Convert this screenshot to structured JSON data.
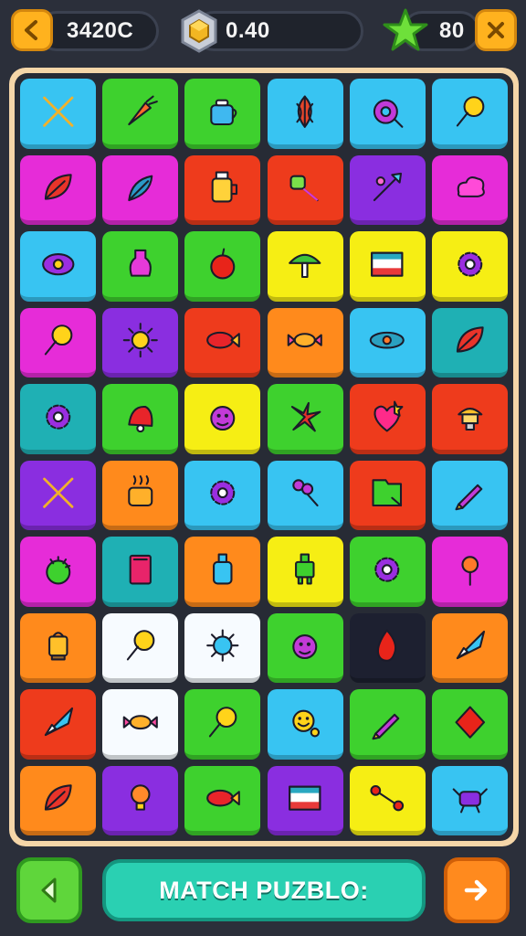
{
  "hud": {
    "score": "3420C",
    "gems": "0.40",
    "stars": "80"
  },
  "footer": {
    "title": "MATCH PUZBLO:"
  },
  "colors": {
    "blue": "#38c4f2",
    "green": "#3ed12e",
    "magenta": "#e62cd8",
    "red": "#ee3b1c",
    "purple": "#8a2ee0",
    "yellow": "#f6ee14",
    "orange": "#ff8a1c",
    "teal": "#1fb0b4",
    "dark": "#1d2030",
    "white": "#f7fbff"
  },
  "board": {
    "columns": 6,
    "rows": 10,
    "tiles": [
      {
        "bg": "blue",
        "icon": "crossed-swords-icon"
      },
      {
        "bg": "green",
        "icon": "carrot-icon"
      },
      {
        "bg": "green",
        "icon": "teapot-icon"
      },
      {
        "bg": "blue",
        "icon": "shell-icon"
      },
      {
        "bg": "blue",
        "icon": "donut-icon"
      },
      {
        "bg": "blue",
        "icon": "lollipop-icon"
      },
      {
        "bg": "magenta",
        "icon": "leaf-icon"
      },
      {
        "bg": "magenta",
        "icon": "feather-icon"
      },
      {
        "bg": "red",
        "icon": "jar-icon"
      },
      {
        "bg": "red",
        "icon": "key-icon"
      },
      {
        "bg": "purple",
        "icon": "arrow-icon"
      },
      {
        "bg": "magenta",
        "icon": "cloud-icon"
      },
      {
        "bg": "blue",
        "icon": "eye-icon"
      },
      {
        "bg": "green",
        "icon": "potion-icon"
      },
      {
        "bg": "green",
        "icon": "apple-icon"
      },
      {
        "bg": "yellow",
        "icon": "mushroom-icon"
      },
      {
        "bg": "yellow",
        "icon": "flag-icon"
      },
      {
        "bg": "yellow",
        "icon": "gear-icon"
      },
      {
        "bg": "magenta",
        "icon": "lollipop-icon"
      },
      {
        "bg": "purple",
        "icon": "sun-icon"
      },
      {
        "bg": "red",
        "icon": "fish-icon"
      },
      {
        "bg": "orange",
        "icon": "candy-icon"
      },
      {
        "bg": "blue",
        "icon": "planet-icon"
      },
      {
        "bg": "teal",
        "icon": "leaf-icon"
      },
      {
        "bg": "teal",
        "icon": "gear-icon"
      },
      {
        "bg": "green",
        "icon": "bell-icon"
      },
      {
        "bg": "yellow",
        "icon": "monster-icon"
      },
      {
        "bg": "green",
        "icon": "flower-icon"
      },
      {
        "bg": "red",
        "icon": "heart-icon"
      },
      {
        "bg": "red",
        "icon": "lamp-icon"
      },
      {
        "bg": "purple",
        "icon": "crossed-swords-icon"
      },
      {
        "bg": "orange",
        "icon": "cauldron-icon"
      },
      {
        "bg": "blue",
        "icon": "gear-icon"
      },
      {
        "bg": "blue",
        "icon": "berries-icon"
      },
      {
        "bg": "red",
        "icon": "folder-icon"
      },
      {
        "bg": "blue",
        "icon": "pencil-icon"
      },
      {
        "bg": "magenta",
        "icon": "ball-icon"
      },
      {
        "bg": "teal",
        "icon": "book-icon"
      },
      {
        "bg": "orange",
        "icon": "bottle-icon"
      },
      {
        "bg": "yellow",
        "icon": "robot-icon"
      },
      {
        "bg": "green",
        "icon": "gear-icon"
      },
      {
        "bg": "magenta",
        "icon": "torch-icon"
      },
      {
        "bg": "orange",
        "icon": "lantern-icon"
      },
      {
        "bg": "white",
        "icon": "lollipop-icon"
      },
      {
        "bg": "white",
        "icon": "virus-icon"
      },
      {
        "bg": "green",
        "icon": "monster-icon"
      },
      {
        "bg": "dark",
        "icon": "flame-icon"
      },
      {
        "bg": "orange",
        "icon": "rocket-icon"
      },
      {
        "bg": "red",
        "icon": "rocket-icon"
      },
      {
        "bg": "white",
        "icon": "candy-icon"
      },
      {
        "bg": "green",
        "icon": "lollipop-icon"
      },
      {
        "bg": "blue",
        "icon": "smiley-icon"
      },
      {
        "bg": "green",
        "icon": "pencil-icon"
      },
      {
        "bg": "green",
        "icon": "diamond-icon"
      },
      {
        "bg": "orange",
        "icon": "leaf-icon"
      },
      {
        "bg": "purple",
        "icon": "bulb-icon"
      },
      {
        "bg": "green",
        "icon": "fish-icon"
      },
      {
        "bg": "purple",
        "icon": "flag-icon"
      },
      {
        "bg": "yellow",
        "icon": "bone-icon"
      },
      {
        "bg": "blue",
        "icon": "crab-icon"
      }
    ]
  }
}
